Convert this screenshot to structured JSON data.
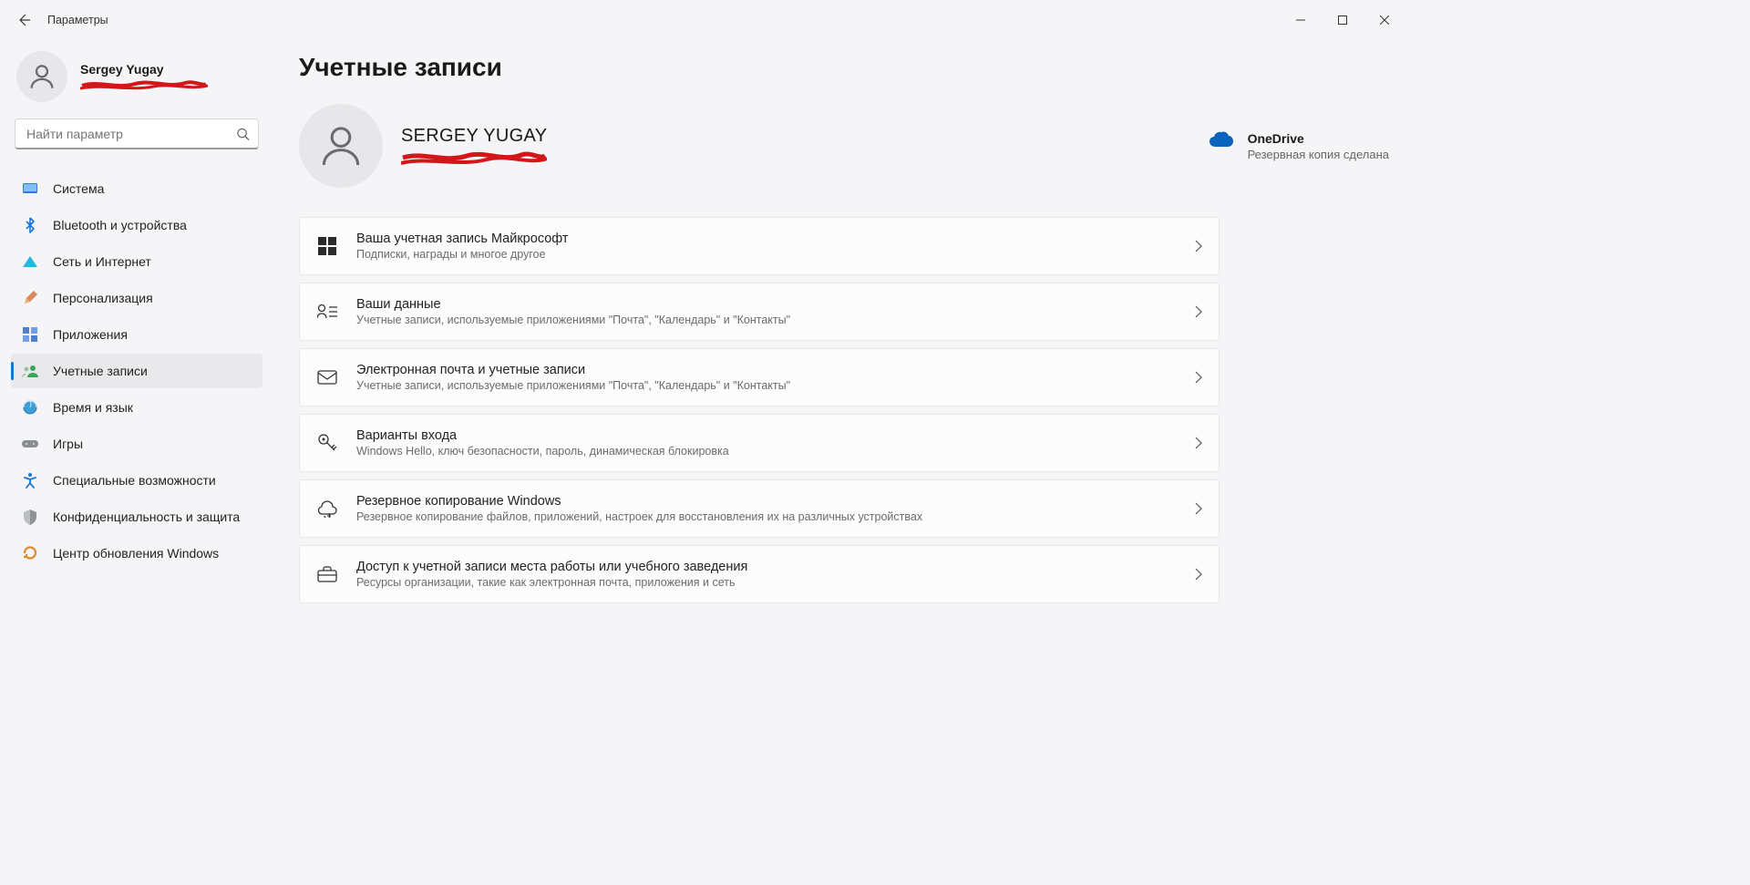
{
  "window": {
    "title": "Параметры"
  },
  "profile": {
    "name": "Sergey Yugay"
  },
  "search": {
    "placeholder": "Найти параметр"
  },
  "sidebar": {
    "items": [
      {
        "label": "Система",
        "icon": "system"
      },
      {
        "label": "Bluetooth и устройства",
        "icon": "bluetooth"
      },
      {
        "label": "Сеть и Интернет",
        "icon": "network"
      },
      {
        "label": "Персонализация",
        "icon": "personalization"
      },
      {
        "label": "Приложения",
        "icon": "apps"
      },
      {
        "label": "Учетные записи",
        "icon": "accounts",
        "selected": true
      },
      {
        "label": "Время и язык",
        "icon": "time"
      },
      {
        "label": "Игры",
        "icon": "gaming"
      },
      {
        "label": "Специальные возможности",
        "icon": "accessibility"
      },
      {
        "label": "Конфиденциальность и защита",
        "icon": "privacy"
      },
      {
        "label": "Центр обновления Windows",
        "icon": "update"
      }
    ]
  },
  "page": {
    "title": "Учетные записи",
    "hero": {
      "display_name": "SERGEY YUGAY"
    },
    "onedrive": {
      "title": "OneDrive",
      "subtitle": "Резервная копия сделана"
    },
    "cards": [
      {
        "icon": "microsoft",
        "title": "Ваша учетная запись Майкрософт",
        "subtitle": "Подписки, награды и многое другое"
      },
      {
        "icon": "yourinfo",
        "title": "Ваши данные",
        "subtitle": "Учетные записи, используемые приложениями \"Почта\", \"Календарь\" и \"Контакты\""
      },
      {
        "icon": "email",
        "title": "Электронная почта и учетные записи",
        "subtitle": "Учетные записи, используемые приложениями \"Почта\", \"Календарь\" и \"Контакты\""
      },
      {
        "icon": "key",
        "title": "Варианты входа",
        "subtitle": "Windows Hello, ключ безопасности, пароль, динамическая блокировка"
      },
      {
        "icon": "backup",
        "title": "Резервное копирование Windows",
        "subtitle": "Резервное копирование файлов, приложений, настроек для восстановления их на различных устройствах"
      },
      {
        "icon": "work",
        "title": "Доступ к учетной записи места работы или учебного заведения",
        "subtitle": "Ресурсы организации, такие как электронная почта, приложения и сеть"
      }
    ]
  }
}
